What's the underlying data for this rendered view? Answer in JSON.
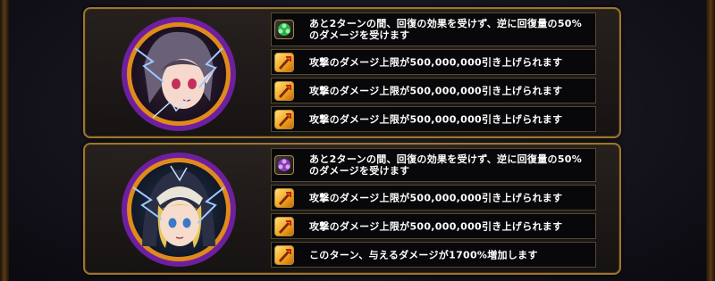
{
  "colors": {
    "frame_gold": "#9a7630",
    "row_bg": "#08080a",
    "text": "#ffffff",
    "attack_icon": "#f0a01e",
    "heal_icon": "#2bb24a"
  },
  "panels": [
    {
      "portrait": "silver-haired-elf-girl-portrait",
      "effects": [
        {
          "icon": "heal-reverse-icon",
          "text": "あと2ターンの間、回復の効果を受けず、逆に回復量の50%のダメージを受けます"
        },
        {
          "icon": "attack-cap-up-icon",
          "text": "攻撃のダメージ上限が500,000,000引き上げられます"
        },
        {
          "icon": "attack-cap-up-icon",
          "text": "攻撃のダメージ上限が500,000,000引き上げられます"
        },
        {
          "icon": "attack-cap-up-icon",
          "text": "攻撃のダメージ上限が500,000,000引き上げられます"
        }
      ]
    },
    {
      "portrait": "blonde-nun-girl-portrait",
      "effects": [
        {
          "icon": "heal-reverse-icon",
          "text": "あと2ターンの間、回復の効果を受けず、逆に回復量の50%のダメージを受けます"
        },
        {
          "icon": "attack-cap-up-icon",
          "text": "攻撃のダメージ上限が500,000,000引き上げられます"
        },
        {
          "icon": "attack-cap-up-icon",
          "text": "攻撃のダメージ上限が500,000,000引き上げられます"
        },
        {
          "icon": "attack-up-icon",
          "text": "このターン、与えるダメージが1700%増加します"
        }
      ]
    }
  ]
}
